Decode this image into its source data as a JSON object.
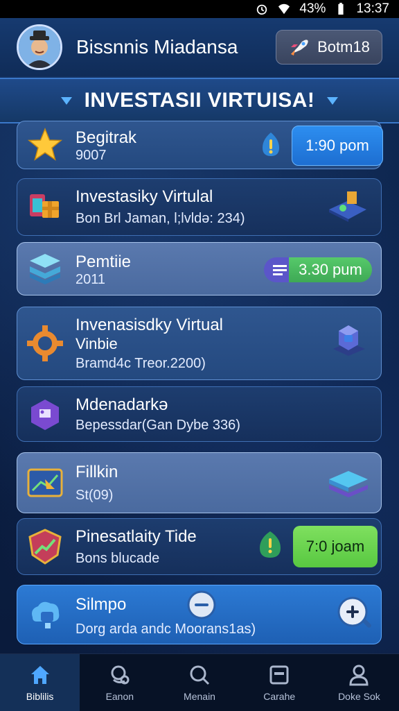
{
  "status_bar": {
    "battery": "43%",
    "time": "13:37"
  },
  "header": {
    "app_title": "Bissnnis Miadansa",
    "button_label": "Botm18"
  },
  "banner": {
    "title": "INVESTASII VIRTUISA!"
  },
  "list": [
    {
      "title": "Begitrak",
      "subtitle": "9007",
      "badge": "1:90 pom"
    },
    {
      "title": "Investasiky Virtulal",
      "subtitle": "Bon Brl Jaman, l;lvldə: 234)"
    },
    {
      "title": "Pemtiie",
      "subtitle": "2011",
      "badge": "3.30 pum"
    },
    {
      "title": "Invenasisdky Virtual",
      "title2": "Vinbie",
      "subtitle": "Bramd4c Treor.2200)"
    },
    {
      "title": "Mdenadarkə",
      "subtitle": "Bepessdar(Gan Dybe 336)"
    },
    {
      "title": "Fillkin",
      "subtitle": "St(09)"
    },
    {
      "title": "Pinesatlaity Tide",
      "subtitle": "Bons blucade",
      "badge": "7:0 joam"
    },
    {
      "title": "Silmpo",
      "subtitle": "Dorg arda andc Moorans1as)"
    }
  ],
  "bottom_nav": [
    {
      "label": "Biblilis",
      "icon": "home-icon",
      "active": true
    },
    {
      "label": "Eanon",
      "icon": "coins-icon",
      "active": false
    },
    {
      "label": "Menain",
      "icon": "search-icon",
      "active": false
    },
    {
      "label": "Carahe",
      "icon": "wallet-icon",
      "active": false
    },
    {
      "label": "Doke Sok",
      "icon": "profile-icon",
      "active": false
    }
  ],
  "colors": {
    "accent_blue": "#2d8ef0",
    "accent_green": "#56c96a",
    "accent_lime": "#7fe05f",
    "background": "#0b1d3c"
  }
}
